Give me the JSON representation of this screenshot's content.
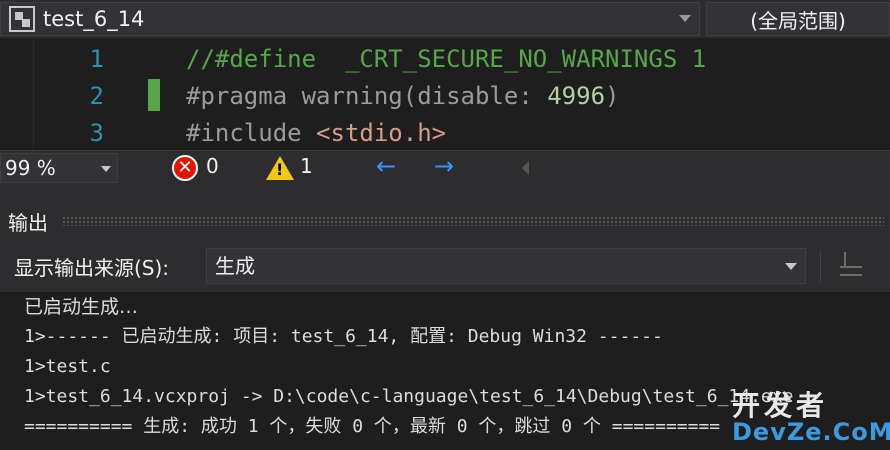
{
  "topbar": {
    "scope": "test_6_14",
    "global_scope": "(全局范围)"
  },
  "editor": {
    "lines": [
      {
        "number": "1",
        "comment": "//#define  _CRT_SECURE_NO_WARNINGS 1"
      },
      {
        "number": "2",
        "prep": "#pragma warning(disable: ",
        "num": "4996",
        "close": ")"
      },
      {
        "number": "3",
        "prep": "#include ",
        "str": "<stdio.h>"
      }
    ]
  },
  "statusbar": {
    "zoom": "99 %",
    "errors": "0",
    "warnings": "1",
    "error_icon_glyph": "✕",
    "warning_icon_glyph": "!",
    "nav_back_glyph": "←",
    "nav_forward_glyph": "→"
  },
  "output_panel": {
    "title": "输出",
    "source_label": "显示输出来源(S):",
    "source_value": "生成",
    "lines": [
      "已启动生成…",
      "1>------ 已启动生成: 项目: test_6_14, 配置: Debug Win32 ------",
      "1>test.c",
      "1>test_6_14.vcxproj -> D:\\code\\c-language\\test_6_14\\Debug\\test_6_14.exe",
      "========== 生成: 成功 1 个，失败 0 个，最新 0 个，跳过 0 个 =========="
    ]
  },
  "watermark": {
    "top": "开发者",
    "bottom": "DevZe.CoM"
  },
  "colors": {
    "background": "#1e1e1e",
    "line_number": "#2b91af",
    "comment": "#57a64a",
    "error": "#e51400",
    "warning": "#f2c811",
    "nav_arrow": "#3794ff"
  }
}
